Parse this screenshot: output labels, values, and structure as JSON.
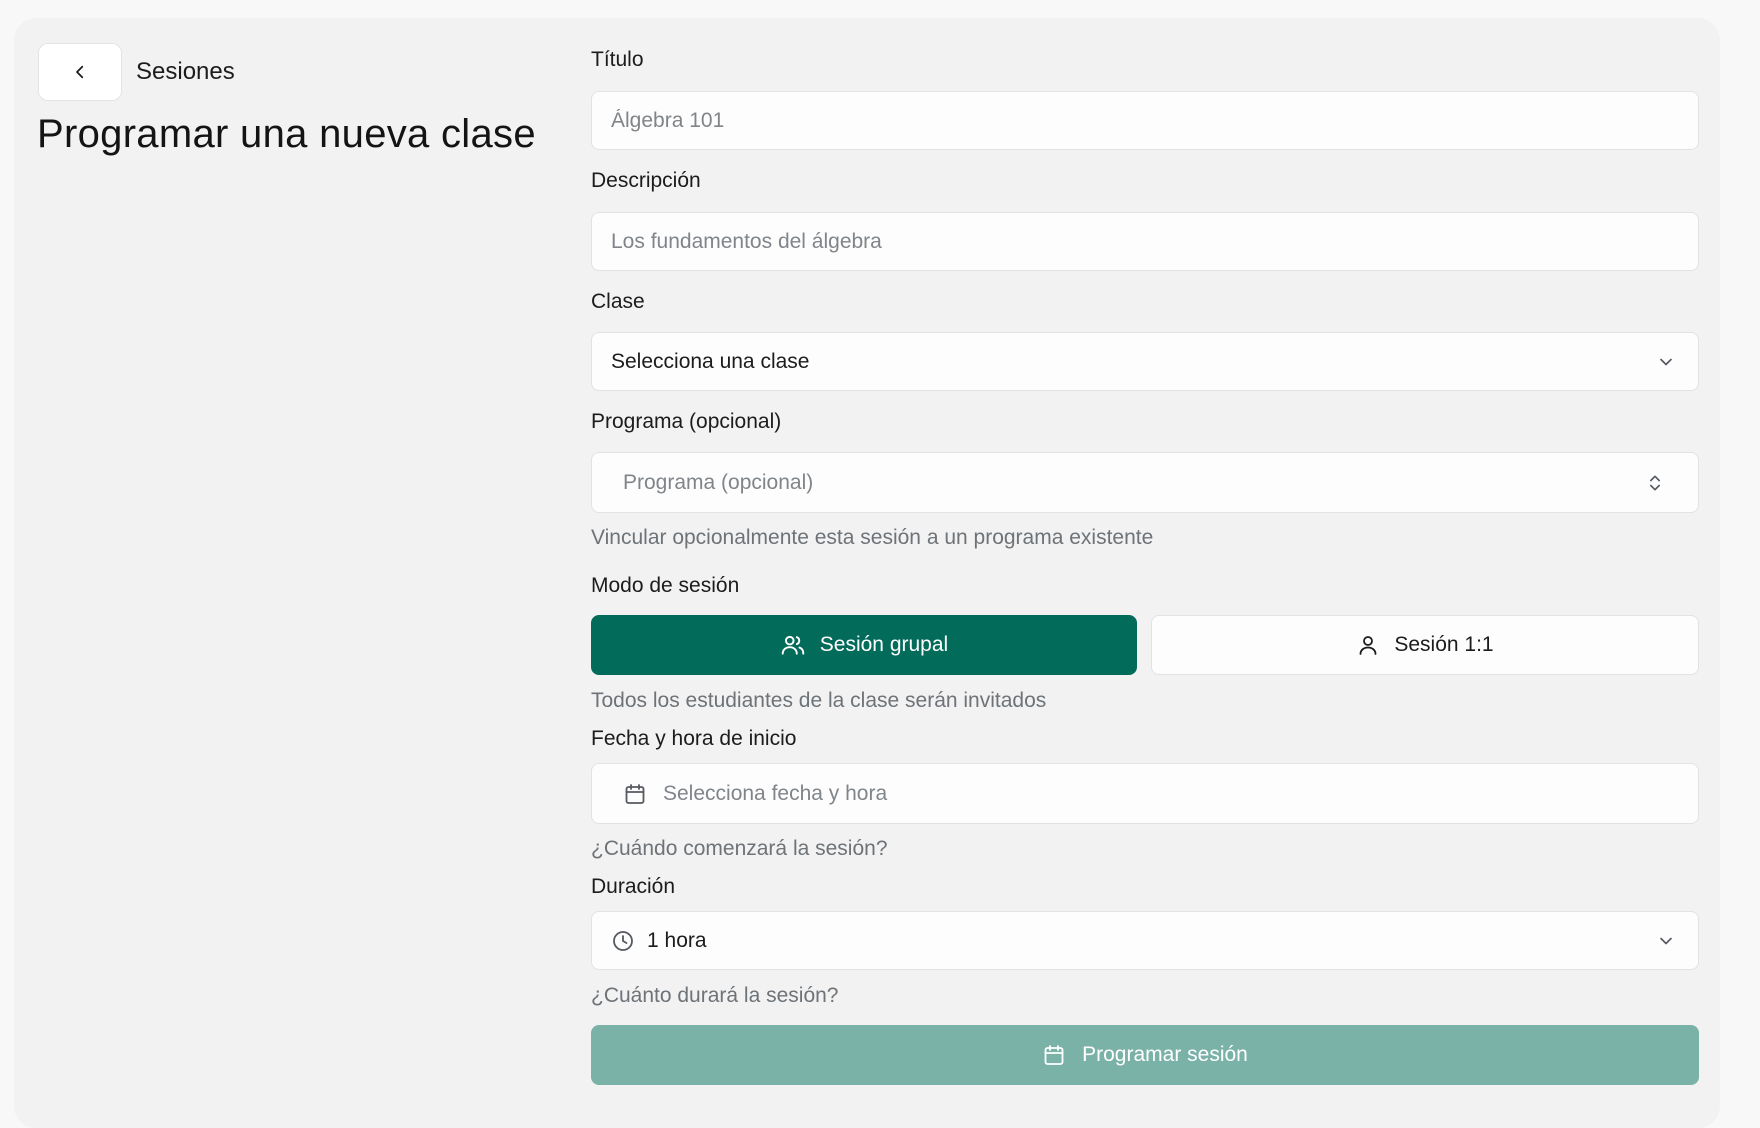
{
  "header": {
    "back_label": "Sesiones",
    "title": "Programar una nueva clase"
  },
  "form": {
    "title": {
      "label": "Título",
      "placeholder": "Álgebra 101"
    },
    "description": {
      "label": "Descripción",
      "placeholder": "Los fundamentos del álgebra"
    },
    "class": {
      "label": "Clase",
      "value": "Selecciona una clase"
    },
    "program": {
      "label": "Programa (opcional)",
      "placeholder": "Programa (opcional)",
      "help": "Vincular opcionalmente esta sesión a un programa existente"
    },
    "mode": {
      "label": "Modo de sesión",
      "group_label": "Sesión grupal",
      "one_label": "Sesión 1:1",
      "selected": "group",
      "help": "Todos los estudiantes de la clase serán invitados"
    },
    "start": {
      "label": "Fecha y hora de inicio",
      "placeholder": "Selecciona fecha y hora",
      "help": "¿Cuándo comenzará la sesión?"
    },
    "duration": {
      "label": "Duración",
      "value": "1 hora",
      "help": "¿Cuánto durará la sesión?"
    },
    "submit_label": "Programar sesión"
  },
  "colors": {
    "primary": "#036b5a",
    "primary_disabled": "#7bb2a8",
    "background": "#f2f2f2"
  },
  "icons": [
    "chevron-left-icon",
    "chevron-down-icon",
    "chevron-up-down-icon",
    "users-icon",
    "user-icon",
    "calendar-icon",
    "clock-icon"
  ]
}
